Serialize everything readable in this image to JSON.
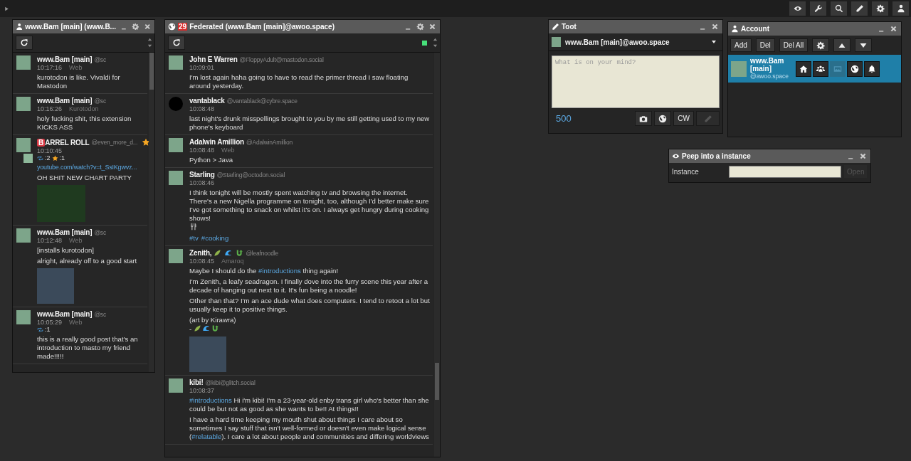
{
  "top_bar": {
    "buttons": [
      {
        "kind": "eye"
      },
      {
        "kind": "wrench"
      },
      {
        "kind": "search"
      },
      {
        "kind": "pencil"
      },
      {
        "kind": "gear"
      },
      {
        "kind": "person"
      }
    ]
  },
  "columns": [
    {
      "kind": "home",
      "title": "www.Bam [main] (www.B...",
      "streaming": false,
      "posts": [
        {
          "name": "www.Bam [main]",
          "handle": "@sc",
          "time": "10:17:16",
          "client": "Web",
          "favourited": false,
          "reblog": false,
          "paragraphs": [
            [
              {
                "kind": "text",
                "text": "kurotodon is like. Vivaldi for Mastodon"
              }
            ]
          ]
        },
        {
          "name": "www.Bam [main]",
          "handle": "@sc",
          "time": "10:16:26",
          "client": "Kurotodon",
          "favourited": false,
          "reblog": false,
          "paragraphs": [
            [
              {
                "kind": "text",
                "text": "holy fucking shit, this extension KICKS ASS"
              }
            ]
          ]
        },
        {
          "name_badge": "B",
          "name": "ARREL ROLL",
          "handle": "@even_more_d...",
          "time": "10:10:45",
          "favourited": true,
          "reblog": true,
          "boosts": ":2",
          "favs": ":1",
          "link": "youtube.com/watch?v=t_SsIKgwvz...",
          "paragraphs": [
            [
              {
                "kind": "text",
                "text": "OH SHIT NEW CHART PARTY"
              }
            ]
          ],
          "media": {
            "kind": "wide"
          }
        },
        {
          "name": "www.Bam [main]",
          "handle": "@sc",
          "time": "10:12:48",
          "client": "Web",
          "favourited": false,
          "reblog": false,
          "paragraphs": [
            [
              {
                "kind": "text",
                "text": "[installs kurotodon]"
              }
            ],
            [
              {
                "kind": "text",
                "text": "alright, already off to a good start"
              }
            ]
          ],
          "media": {
            "kind": "square"
          }
        },
        {
          "name": "www.Bam [main]",
          "handle": "@sc",
          "time": "10:05:29",
          "client": "Web",
          "favourited": false,
          "reblog": false,
          "boosts": ":1",
          "paragraphs": [
            [
              {
                "kind": "text",
                "text": "this is a really good post that's an introduction to masto my friend made!!!!!"
              }
            ]
          ]
        }
      ]
    },
    {
      "kind": "federated",
      "badge": "29",
      "title": "Federated (www.Bam [main]@awoo.space)",
      "streaming": true,
      "posts": [
        {
          "name": "John E Warren",
          "handle": "@FloppyAdult@mastodon.social",
          "time": "10:09:01",
          "favourited": false,
          "reblog": false,
          "paragraphs": [
            [
              {
                "kind": "text",
                "text": "I'm lost again haha going to have to read the primer thread I saw floating around yesterday."
              }
            ]
          ]
        },
        {
          "name": "vantablack",
          "handle": "@vantablack@cybre.space",
          "time": "10:08:48",
          "avatar": {
            "kind": "circle"
          },
          "favourited": false,
          "reblog": false,
          "paragraphs": [
            [
              {
                "kind": "text",
                "text": "last night's drunk misspellings brought to you by me still getting used to my new phone's keyboard"
              }
            ]
          ]
        },
        {
          "name": "Adalwin Amillion",
          "handle": "@AdalwinAmillion",
          "time": "10:08:48",
          "client": "Web",
          "favourited": false,
          "reblog": false,
          "paragraphs": [
            [
              {
                "kind": "text",
                "text": "Python > Java"
              }
            ]
          ]
        },
        {
          "name": "Starling",
          "handle": "@Starling@octodon.social",
          "time": "10:08:46",
          "favourited": false,
          "reblog": false,
          "paragraphs": [
            [
              {
                "kind": "text",
                "text": "I think tonight will be mostly spent watching tv and browsing the internet. There's a new Nigella programme on tonight, too, although I'd better make sure I've got something to snack on whilst it's on. I always get hungry during cooking shows!\n"
              },
              {
                "kind": "utensils"
              }
            ],
            [
              {
                "kind": "tag",
                "text": "#tv"
              },
              {
                "kind": "tag",
                "text": "#cooking"
              }
            ]
          ]
        },
        {
          "name": "Zenith,",
          "name_emojis": [
            {
              "kind": "leaf"
            },
            {
              "kind": "wave"
            },
            {
              "kind": "dragon"
            }
          ],
          "handle": "@leafnoodle",
          "time": "10:08:45",
          "client": "Amaroq",
          "favourited": false,
          "reblog": false,
          "paragraphs": [
            [
              {
                "kind": "text",
                "text": "Maybe I should do the "
              },
              {
                "kind": "tag",
                "text": "#introductions"
              },
              {
                "kind": "text",
                "text": " thing again!"
              }
            ],
            [
              {
                "kind": "text",
                "text": "I'm Zenith, a leafy seadragon. I finally dove into the furry scene this year after a decade of hanging out next to it. It's fun being a noodle!"
              }
            ],
            [
              {
                "kind": "text",
                "text": "Other than that? I'm an ace dude what does computers. I tend to retoot a lot but usually keep it to positive things."
              }
            ],
            [
              {
                "kind": "text",
                "text": "(art by Kirawra)\n- "
              },
              {
                "kind": "leaf"
              },
              {
                "kind": "wave"
              },
              {
                "kind": "dragon"
              }
            ]
          ],
          "media": {
            "kind": "square"
          }
        },
        {
          "name": "kibi!",
          "handle": "@kibi@glitch.social",
          "time": "10:08:37",
          "favourited": false,
          "reblog": false,
          "paragraphs": [
            [
              {
                "kind": "tag",
                "text": "#introductions"
              },
              {
                "kind": "text",
                "text": " Hi i'm kibi! I'm a 23-year-old enby trans girl who's better than she could be but not as good as she wants to be!! At things!!"
              }
            ],
            [
              {
                "kind": "text",
                "text": "I have a hard time keeping my mouth shut about things I care about so sometimes I say stuff that isn't well-formed or doesn't even make logical sense ("
              },
              {
                "kind": "tag",
                "text": "#relatable"
              },
              {
                "kind": "text",
                "text": "). I care a lot about people and communities and differing worldviews"
              }
            ]
          ]
        }
      ]
    }
  ],
  "toot": {
    "title": "Toot",
    "account": "www.Bam [main]@awoo.space",
    "placeholder": "What is on your mind?",
    "counter": "500",
    "buttons": [
      {
        "kind": "camera",
        "disabled": false
      },
      {
        "kind": "globe",
        "disabled": false
      },
      {
        "kind": "text",
        "label": "CW",
        "disabled": false
      },
      {
        "kind": "pencil",
        "disabled": true
      }
    ]
  },
  "account": {
    "title": "Account",
    "buttons": [
      {
        "kind": "text",
        "label": "Add"
      },
      {
        "kind": "text",
        "label": "Del"
      },
      {
        "kind": "text",
        "label": "Del All"
      },
      {
        "kind": "gear"
      },
      {
        "kind": "up"
      },
      {
        "kind": "down"
      }
    ],
    "accounts": [
      {
        "name": "www.Bam [main]",
        "handle": "@awoo.space",
        "selected": true,
        "buttons": [
          {
            "kind": "home",
            "disabled": false
          },
          {
            "kind": "people",
            "disabled": false
          },
          {
            "kind": "image",
            "disabled": true
          },
          {
            "kind": "globe",
            "disabled": false
          },
          {
            "kind": "bell",
            "disabled": false
          }
        ]
      }
    ]
  },
  "peep": {
    "title": "Peep into a instance",
    "label": "Instance",
    "button": {
      "label": "Open",
      "disabled": true
    }
  }
}
